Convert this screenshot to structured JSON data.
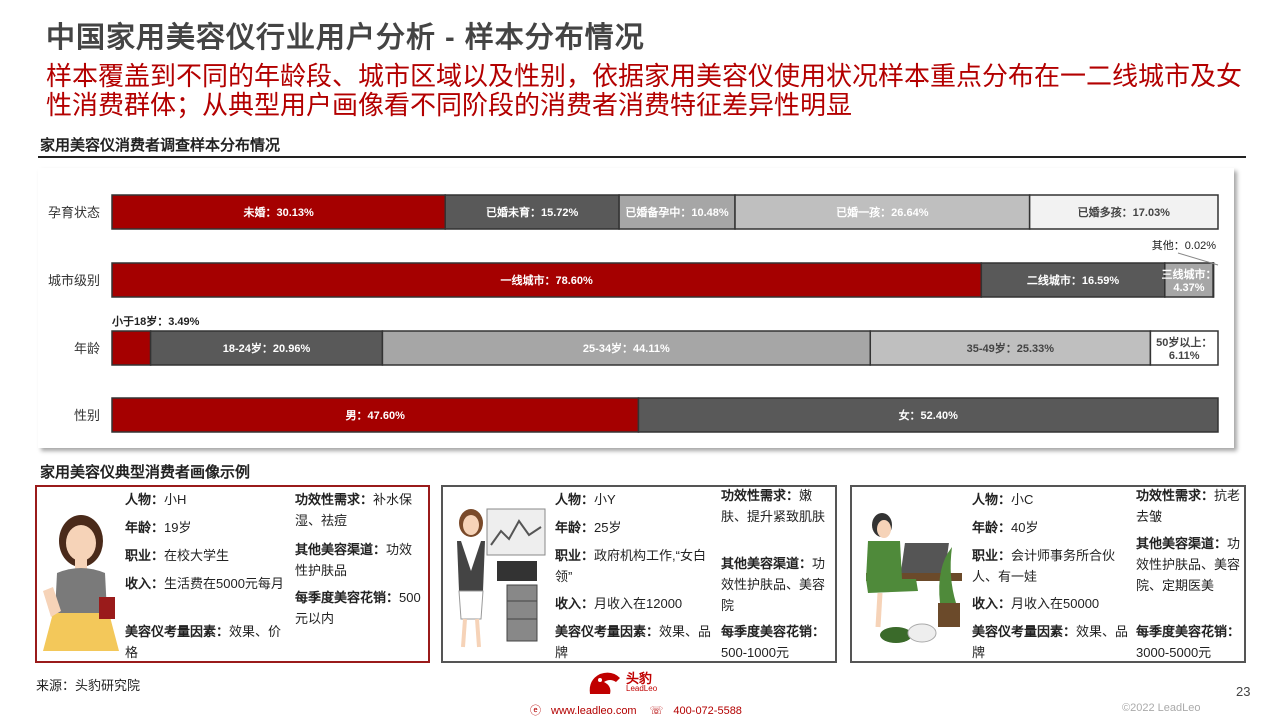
{
  "title": "中国家用美容仪行业用户分析 - 样本分布情况",
  "subtitle": "样本覆盖到不同的年龄段、城市区域以及性别，依据家用美容仪使用状况样本重点分布在一二线城市及女性消费群体；从典型用户画像看不同阶段的消费者消费特征差异性明显",
  "chart_section_title": "家用美容仪消费者调查样本分布情况",
  "chart_data": {
    "type": "bar",
    "orientation": "horizontal-100%-stacked",
    "categories": [
      "孕育状态",
      "城市级别",
      "年龄",
      "性别"
    ],
    "rows": [
      {
        "category": "孕育状态",
        "segments": [
          {
            "label": "未婚：30.13%",
            "value": 30.13,
            "color": "#a50000",
            "text_color": "#ffffff"
          },
          {
            "label": "已婚未育：15.72%",
            "value": 15.72,
            "color": "#595959",
            "text_color": "#ffffff"
          },
          {
            "label": "已婚备孕中：10.48%",
            "value": 10.48,
            "color": "#a6a6a6",
            "text_color": "#ffffff"
          },
          {
            "label": "已婚一孩：26.64%",
            "value": 26.64,
            "color": "#bfbfbf",
            "text_color": "#ffffff"
          },
          {
            "label": "已婚多孩：17.03%",
            "value": 17.03,
            "color": "#f2f2f2",
            "text_color": "#444444"
          }
        ]
      },
      {
        "category": "城市级别",
        "segments": [
          {
            "label": "一线城市：78.60%",
            "value": 78.6,
            "color": "#a50000",
            "text_color": "#ffffff"
          },
          {
            "label": "二线城市：16.59%",
            "value": 16.59,
            "color": "#595959",
            "text_color": "#ffffff"
          },
          {
            "label": "三线城市：4.37%",
            "value": 4.37,
            "color": "#a6a6a6",
            "text_color": "#ffffff"
          },
          {
            "label": "其他：0.02%",
            "value": 0.02,
            "color": "#bfbfbf",
            "text_color": "#222222"
          }
        ]
      },
      {
        "category": "年龄",
        "segments": [
          {
            "label": "小于18岁：3.49%",
            "value": 3.49,
            "color": "#a50000",
            "text_color": "#222222"
          },
          {
            "label": "18-24岁：20.96%",
            "value": 20.96,
            "color": "#595959",
            "text_color": "#ffffff"
          },
          {
            "label": "25-34岁：44.11%",
            "value": 44.11,
            "color": "#a6a6a6",
            "text_color": "#ffffff"
          },
          {
            "label": "35-49岁：25.33%",
            "value": 25.33,
            "color": "#bfbfbf",
            "text_color": "#444444"
          },
          {
            "label": "50岁以上：6.11%",
            "value": 6.11,
            "color": "#ffffff",
            "text_color": "#444444"
          }
        ]
      },
      {
        "category": "性别",
        "segments": [
          {
            "label": "男：47.60%",
            "value": 47.6,
            "color": "#a50000",
            "text_color": "#ffffff"
          },
          {
            "label": "女：52.40%",
            "value": 52.4,
            "color": "#595959",
            "text_color": "#ffffff"
          }
        ]
      }
    ],
    "xlim": [
      0,
      100
    ],
    "legend": "none"
  },
  "persona_section_title": "家用美容仪典型消费者画像示例",
  "personas": [
    {
      "person_label": "人物：",
      "person_value": "小H",
      "age_label": "年龄：",
      "age_value": "19岁",
      "job_label": "职业：",
      "job_value": "在校大学生",
      "income_label": "收入：",
      "income_value": "生活费在5000元每月",
      "factor_label": "美容仪考量因素：",
      "factor_value": "效果、价格",
      "need_label": "功效性需求：",
      "need_value": "补水保湿、祛痘",
      "channel_label": "其他美容渠道：",
      "channel_value": "功效性护肤品",
      "spend_label": "每季度美容花销：",
      "spend_value": "500元以内"
    },
    {
      "person_label": "人物：",
      "person_value": "小Y",
      "age_label": "年龄：",
      "age_value": "25岁",
      "job_label": "职业：",
      "job_value": "政府机构工作,“女白领”",
      "income_label": "收入：",
      "income_value": "月收入在12000",
      "factor_label": "美容仪考量因素：",
      "factor_value": "效果、品牌",
      "need_label": "功效性需求：",
      "need_value": "嫩肤、提升紧致肌肤",
      "channel_label": "其他美容渠道：",
      "channel_value": "功效性护肤品、美容院",
      "spend_label": "每季度美容花销：",
      "spend_value": "500-1000元"
    },
    {
      "person_label": "人物：",
      "person_value": "小C",
      "age_label": "年龄：",
      "age_value": "40岁",
      "job_label": "职业：",
      "job_value": "会计师事务所合伙人、有一娃",
      "income_label": "收入：",
      "income_value": "月收入在50000",
      "factor_label": "美容仪考量因素：",
      "factor_value": "效果、品牌",
      "need_label": "功效性需求：",
      "need_value": "抗老去皱",
      "channel_label": "其他美容渠道：",
      "channel_value": "功效性护肤品、美容院、定期医美",
      "spend_label": "每季度美容花销：",
      "spend_value": "3000-5000元"
    }
  ],
  "footer": {
    "source": "来源：头豹研究院",
    "logo_text": "头豹",
    "logo_sub": "LeadLeo",
    "website": "www.leadleo.com",
    "phone": "400-072-5588",
    "copyright": "©2022 LeadLeo",
    "page_number": "23"
  },
  "colors": {
    "brand_red": "#a50000",
    "title_gray": "#444444"
  }
}
